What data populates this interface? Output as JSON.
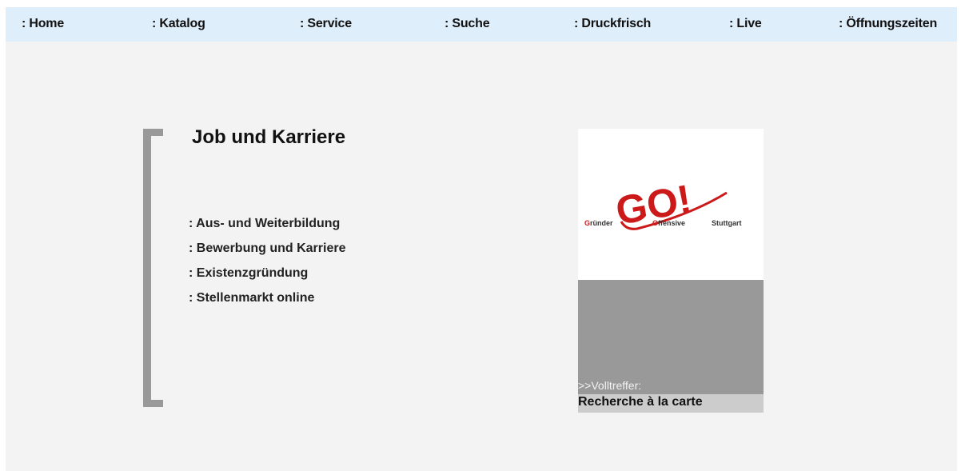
{
  "nav": {
    "items": [
      {
        "label": ": Home"
      },
      {
        "label": ": Katalog"
      },
      {
        "label": ": Service"
      },
      {
        "label": ": Suche"
      },
      {
        "label": ": Druckfrisch"
      },
      {
        "label": ": Live"
      },
      {
        "label": ": Öffnungszeiten"
      }
    ]
  },
  "main": {
    "heading": "Job und Karriere",
    "links": [
      {
        "label": ": Aus- und Weiterbildung"
      },
      {
        "label": ": Bewerbung und Karriere"
      },
      {
        "label": ": Existenzgründung"
      },
      {
        "label": ": Stellenmarkt online"
      }
    ]
  },
  "promo": {
    "logo": {
      "mark": "GO!",
      "word1_initial": "G",
      "word1_rest": "ründer",
      "word2_initial": "O",
      "word2_rest": "ffensive",
      "word3": "Stuttgart"
    },
    "caption": ">>Volltreffer:",
    "link": "Recherche à la carte"
  },
  "colors": {
    "nav_bg": "#dfeefb",
    "page_bg": "#f3f3f3",
    "bracket": "#999999",
    "promo_gray": "#999999",
    "promo_bar": "#cccccc",
    "logo_red": "#cc1a1a"
  }
}
